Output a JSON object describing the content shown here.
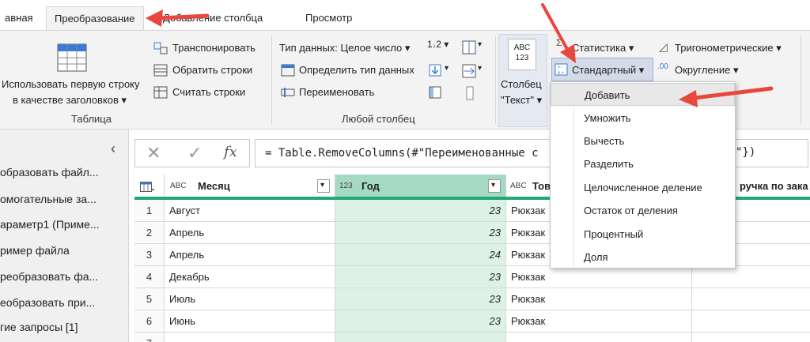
{
  "tabs": [
    "авная",
    "Преобразование",
    "Добавление столбца",
    "Просмотр"
  ],
  "ribbon": {
    "use_first_row_line1": "Использовать первую строку",
    "use_first_row_line2": "в качестве заголовков",
    "transpose": "Транспонировать",
    "reverse_rows": "Обратить строки",
    "count_rows": "Считать строки",
    "group_table": "Таблица",
    "data_type": "Тип данных: Целое число",
    "detect_type": "Определить тип данных",
    "rename": "Переименовать",
    "group_any_column": "Любой столбец",
    "text_column_line1": "Столбец",
    "text_column_line2": "\"Текст\"",
    "abc_line1": "ABC",
    "abc_line2": "123",
    "statistics": "Статистика",
    "standard": "Стандартный",
    "trigonometric": "Тригонометрические",
    "rounding": "Округление",
    "rounding_icon_text": ".00"
  },
  "menu": {
    "items": [
      "Добавить",
      "Умножить",
      "Вычесть",
      "Разделить",
      "Целочисленное деление",
      "Остаток от деления",
      "Процентный",
      "Доля"
    ]
  },
  "queries": [
    "образовать файл...",
    "омогательные за...",
    "араметр1 (Приме...",
    "ример файла",
    "реобразовать фа...",
    "еобразовать при...",
    "гие запросы [1]"
  ],
  "formula": {
    "fx": "fx",
    "text": "= Table.RemoveColumns(#\"Переименованные с",
    "tail": "\"})"
  },
  "grid": {
    "columns": [
      {
        "type_icon": "ABC",
        "name": "Месяц"
      },
      {
        "type_icon": "123",
        "name": "Год"
      },
      {
        "type_icon": "ABC",
        "name": "Тов"
      },
      {
        "type_icon": "",
        "name": "ручка по зака"
      }
    ],
    "rows": [
      {
        "idx": "1",
        "month": "Август",
        "year": "23",
        "product": "Рюкзак"
      },
      {
        "idx": "2",
        "month": "Апрель",
        "year": "23",
        "product": "Рюкзак"
      },
      {
        "idx": "3",
        "month": "Апрель",
        "year": "24",
        "product": "Рюкзак"
      },
      {
        "idx": "4",
        "month": "Декабрь",
        "year": "23",
        "product": "Рюкзак"
      },
      {
        "idx": "5",
        "month": "Июль",
        "year": "23",
        "product": "Рюкзак"
      },
      {
        "idx": "6",
        "month": "Июнь",
        "year": "23",
        "product": "Рюкзак"
      },
      {
        "idx": "7",
        "month": "",
        "year": "",
        "product": ""
      }
    ]
  },
  "colors": {
    "accent": "#21a87a",
    "selected_column": "#ddf1e7",
    "annotation_arrow": "#e8473e"
  }
}
